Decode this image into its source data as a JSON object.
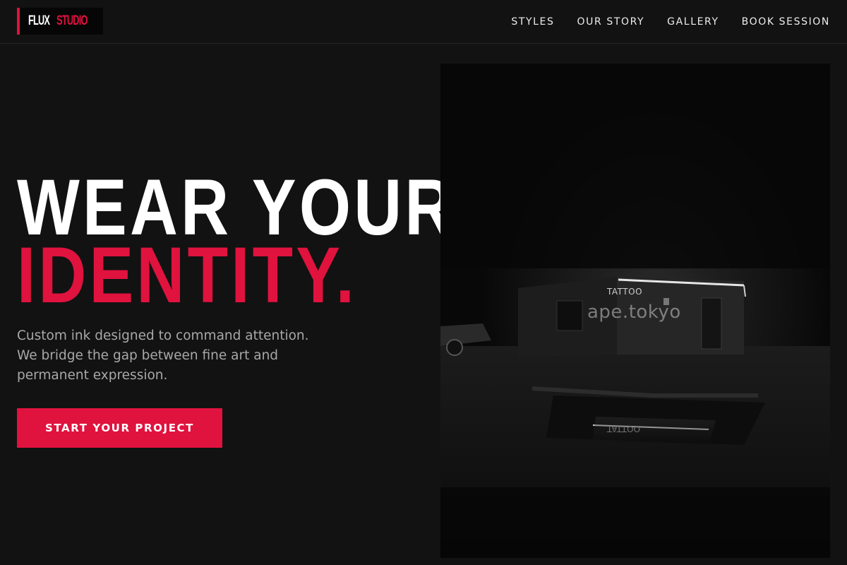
{
  "nav": {
    "logo": {
      "word1": "FLUX",
      "word2": "STUDIO"
    },
    "links": [
      "STYLES",
      "OUR STORY",
      "GALLERY",
      "BOOK SESSION"
    ]
  },
  "hero": {
    "headline_line1": "WEAR YOUR",
    "headline_line2": "IDENTITY.",
    "lede": "Custom ink designed to command attention. We bridge the gap between fine art and permanent expression.",
    "cta_label": "START YOUR PROJECT"
  },
  "photo": {
    "sign_text": "TATTOO",
    "watermark": "ape.tokyo"
  },
  "colors": {
    "background": "#121212",
    "accent": "#e0123e",
    "text": "#ffffff",
    "muted_text": "#a8a8a8"
  }
}
